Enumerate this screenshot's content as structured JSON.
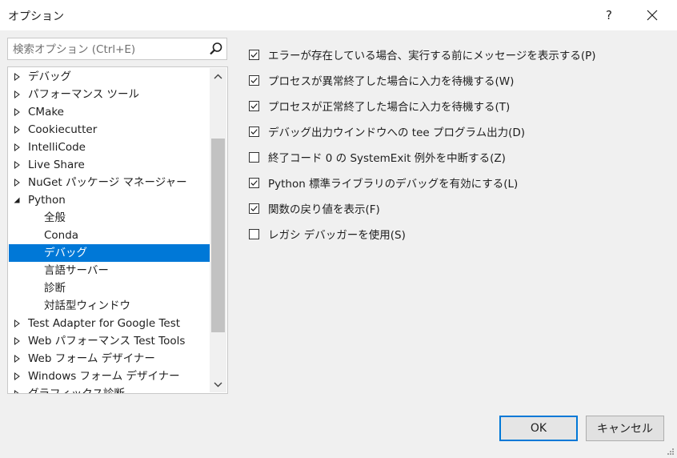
{
  "window": {
    "title": "オプション",
    "help_label": "?",
    "close_icon": "close-icon"
  },
  "search": {
    "placeholder": "検索オプション (Ctrl+E)",
    "value": ""
  },
  "tree": {
    "items": [
      {
        "label": "デバッグ",
        "level": 0,
        "expander": "collapsed"
      },
      {
        "label": "パフォーマンス ツール",
        "level": 0,
        "expander": "collapsed"
      },
      {
        "label": "CMake",
        "level": 0,
        "expander": "collapsed"
      },
      {
        "label": "Cookiecutter",
        "level": 0,
        "expander": "collapsed"
      },
      {
        "label": "IntelliCode",
        "level": 0,
        "expander": "collapsed"
      },
      {
        "label": "Live Share",
        "level": 0,
        "expander": "collapsed"
      },
      {
        "label": "NuGet パッケージ マネージャー",
        "level": 0,
        "expander": "collapsed"
      },
      {
        "label": "Python",
        "level": 0,
        "expander": "expanded"
      },
      {
        "label": "全般",
        "level": 1,
        "expander": "none"
      },
      {
        "label": "Conda",
        "level": 1,
        "expander": "none"
      },
      {
        "label": "デバッグ",
        "level": 1,
        "expander": "none",
        "selected": true
      },
      {
        "label": "言語サーバー",
        "level": 1,
        "expander": "none"
      },
      {
        "label": "診断",
        "level": 1,
        "expander": "none"
      },
      {
        "label": "対話型ウィンドウ",
        "level": 1,
        "expander": "none"
      },
      {
        "label": "Test Adapter for Google Test",
        "level": 0,
        "expander": "collapsed"
      },
      {
        "label": "Web パフォーマンス Test Tools",
        "level": 0,
        "expander": "collapsed"
      },
      {
        "label": "Web フォーム デザイナー",
        "level": 0,
        "expander": "collapsed"
      },
      {
        "label": "Windows フォーム デザイナー",
        "level": 0,
        "expander": "collapsed"
      },
      {
        "label": "グラフィックス診断",
        "level": 0,
        "expander": "collapsed"
      }
    ]
  },
  "options": [
    {
      "label": "エラーが存在している場合、実行する前にメッセージを表示する(P)",
      "checked": true
    },
    {
      "label": "プロセスが異常終了した場合に入力を待機する(W)",
      "checked": true
    },
    {
      "label": "プロセスが正常終了した場合に入力を待機する(T)",
      "checked": true
    },
    {
      "label": "デバッグ出力ウインドウへの tee プログラム出力(D)",
      "checked": true
    },
    {
      "label": "終了コード 0 の SystemExit 例外を中断する(Z)",
      "checked": false
    },
    {
      "label": "Python 標準ライブラリのデバッグを有効にする(L)",
      "checked": true
    },
    {
      "label": "関数の戻り値を表示(F)",
      "checked": true
    },
    {
      "label": "レガシ デバッガーを使用(S)",
      "checked": false
    }
  ],
  "buttons": {
    "ok": "OK",
    "cancel": "キャンセル"
  },
  "colors": {
    "accent": "#0078d7",
    "background": "#f0f0f0",
    "panel": "#ffffff",
    "scroll_thumb": "#c2c2c2"
  }
}
